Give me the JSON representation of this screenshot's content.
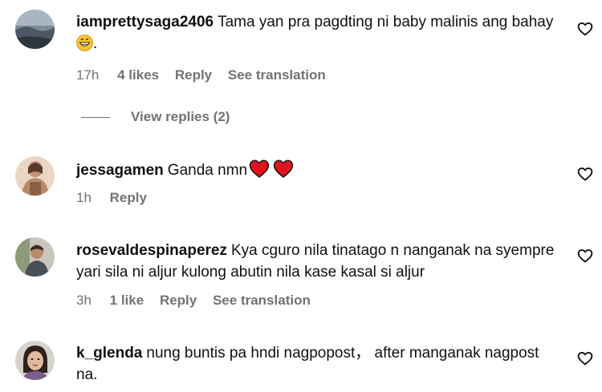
{
  "comments": [
    {
      "username": "iamprettysaga2406",
      "text": "Tama yan pra pagdting ni baby malinis ang bahay",
      "text_suffix": ".",
      "time": "17h",
      "likes": "4 likes",
      "reply": "Reply",
      "translate": "See translation",
      "view_replies": "View replies (2)"
    },
    {
      "username": "jessagamen",
      "text": "Ganda nmn",
      "time": "1h",
      "reply": "Reply"
    },
    {
      "username": "rosevaldespinaperez",
      "text": "Kya cguro nila tinatago n nanganak na syempre yari sila ni aljur kulong abutin nila kase kasal si aljur",
      "time": "3h",
      "likes": "1 like",
      "reply": "Reply",
      "translate": "See translation"
    },
    {
      "username": "k_glenda",
      "text": "nung buntis pa hndi nagpopost， after manganak nagpost na."
    }
  ],
  "colors": {
    "text": "#111111",
    "muted": "#737373",
    "heart_red": "#e0141e"
  },
  "icons": [
    "heart-outline-icon",
    "grinning-emoji-icon",
    "red-heart-emoji-icon"
  ]
}
